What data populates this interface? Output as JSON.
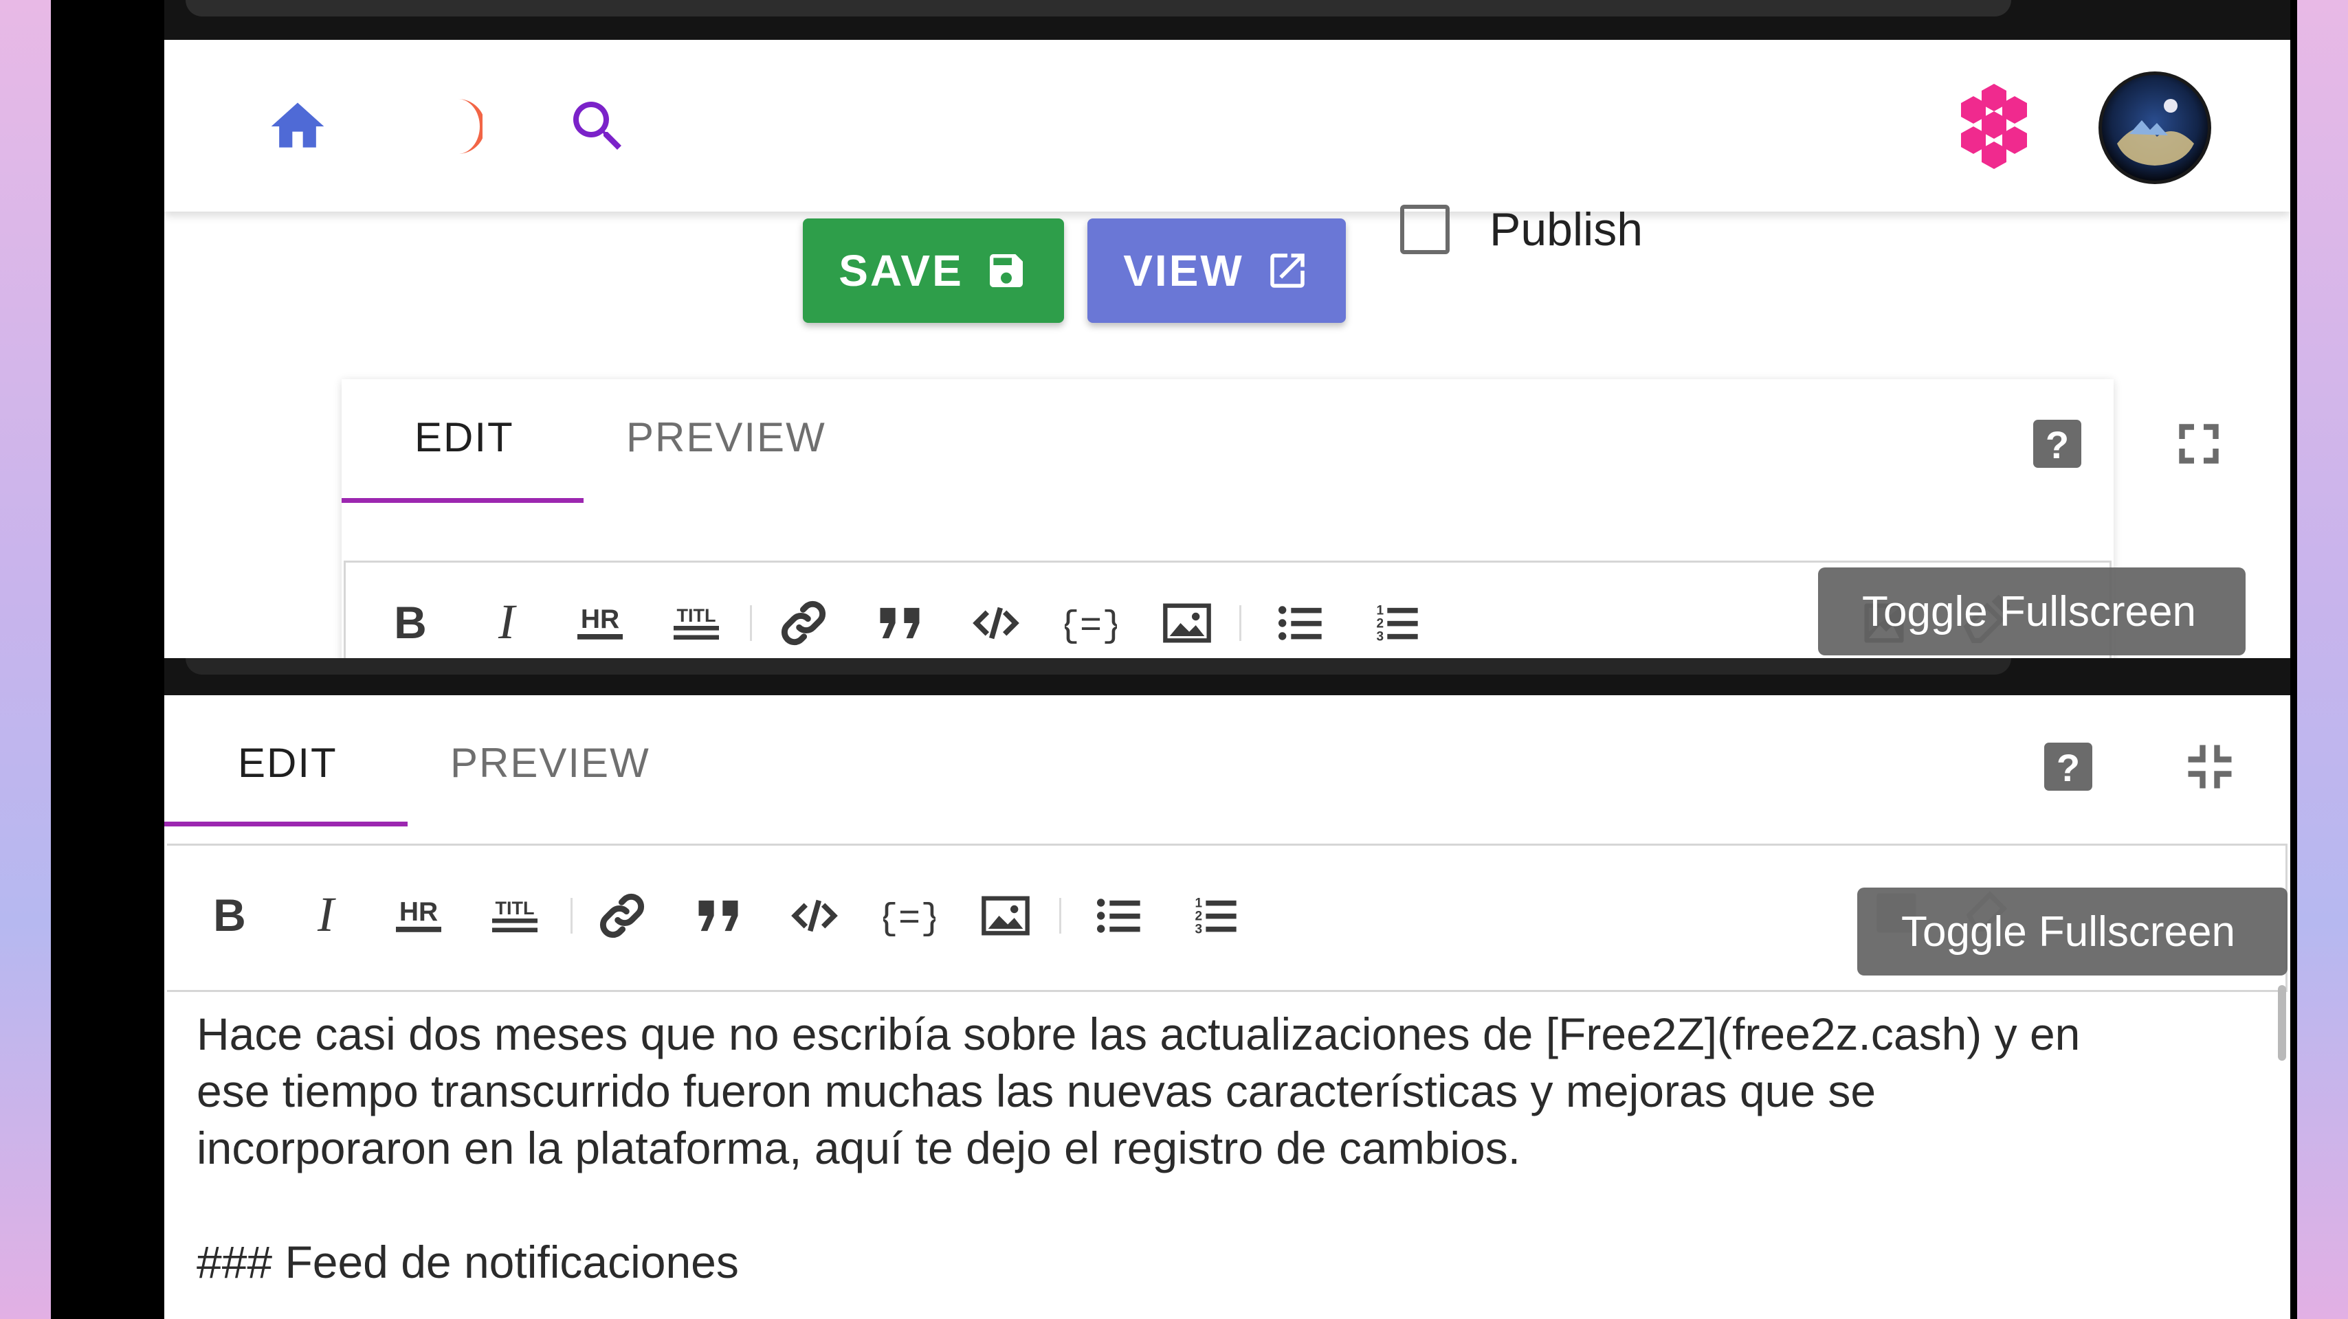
{
  "nav": {
    "icons": [
      "home-icon",
      "moon-icon",
      "search-icon",
      "honeycomb-logo-icon",
      "user-avatar"
    ],
    "colors": {
      "home": "#4f6ad6",
      "moon": "#f26546",
      "search": "#7b22c9",
      "logo": "#f02a8e"
    }
  },
  "actions": {
    "save_label": "SAVE",
    "view_label": "VIEW",
    "publish_label": "Publish",
    "publish_checked": false,
    "save_color": "#2e9e4a",
    "view_color": "#6a77d6"
  },
  "editor_top": {
    "tabs": [
      {
        "label": "EDIT",
        "active": true
      },
      {
        "label": "PREVIEW",
        "active": false
      }
    ],
    "tooltip": "Toggle Fullscreen"
  },
  "editor_bottom": {
    "tabs": [
      {
        "label": "EDIT",
        "active": true
      },
      {
        "label": "PREVIEW",
        "active": false
      }
    ],
    "tooltip": "Toggle Fullscreen",
    "content": "Hace casi dos meses que no escribía sobre las actualizaciones de [Free2Z](free2z.cash) y en\nese tiempo transcurrido fueron muchas las nuevas características y mejoras que se\nincorporaron en la plataforma, aquí te dejo el registro de cambios.\n\n### Feed de notificaciones"
  },
  "toolbar_items": [
    "bold",
    "italic",
    "horizontal-rule",
    "title",
    "link",
    "quote",
    "code",
    "code-block",
    "image",
    "bullet-list",
    "numbered-list"
  ],
  "accent_color": "#9c27b0"
}
